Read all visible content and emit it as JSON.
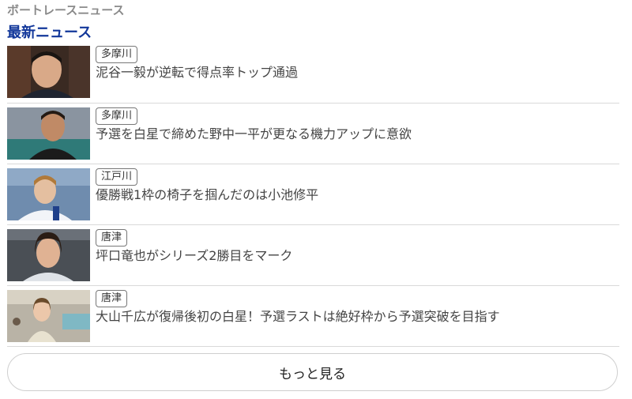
{
  "section": {
    "label": "ボートレースニュース"
  },
  "heading": "最新ニュース",
  "news": [
    {
      "tag": "多摩川",
      "title": "泥谷一毅が逆転で得点率トップ通過"
    },
    {
      "tag": "多摩川",
      "title": "予選を白星で締めた野中一平が更なる機力アップに意欲"
    },
    {
      "tag": "江戸川",
      "title": "優勝戦1枠の椅子を掴んだのは小池修平"
    },
    {
      "tag": "唐津",
      "title": "坪口竜也がシリーズ2勝目をマーク"
    },
    {
      "tag": "唐津",
      "title": "大山千広が復帰後初の白星！予選ラストは絶好枠から予選突破を目指す"
    }
  ],
  "more_button": "もっと見る"
}
